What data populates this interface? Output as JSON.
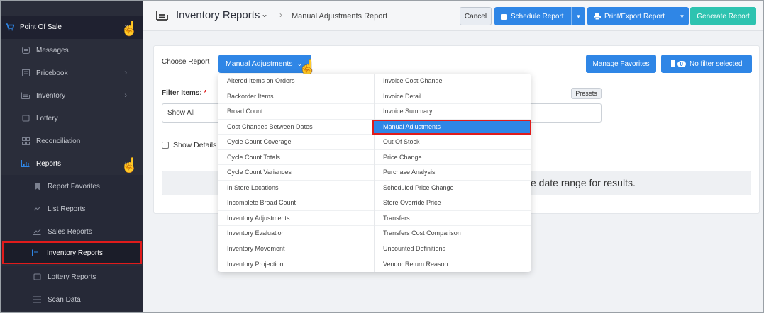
{
  "sidebar": {
    "pos_label": "Point Of Sale",
    "items": [
      {
        "label": "Messages",
        "icon": "messages-icon"
      },
      {
        "label": "Pricebook",
        "icon": "pricebook-icon"
      },
      {
        "label": "Inventory",
        "icon": "inventory-icon"
      },
      {
        "label": "Lottery",
        "icon": "lottery-icon"
      },
      {
        "label": "Reconciliation",
        "icon": "reconciliation-icon"
      },
      {
        "label": "Reports",
        "icon": "reports-icon"
      }
    ],
    "sub_items": [
      {
        "label": "Report Favorites",
        "icon": "bookmark-icon"
      },
      {
        "label": "List Reports",
        "icon": "list-chart-icon"
      },
      {
        "label": "Sales Reports",
        "icon": "sales-chart-icon"
      },
      {
        "label": "Inventory Reports",
        "icon": "inventory-report-icon"
      },
      {
        "label": "Lottery Reports",
        "icon": "lottery-report-icon"
      },
      {
        "label": "Scan Data",
        "icon": "scan-data-icon"
      }
    ]
  },
  "header": {
    "title": "Inventory Reports",
    "breadcrumb": "Manual Adjustments Report",
    "cancel": "Cancel",
    "schedule": "Schedule Report",
    "print": "Print/Export Report",
    "generate": "Generate Report"
  },
  "card": {
    "choose_report_label": "Choose Report",
    "selected_report": "Manual Adjustments",
    "manage_favorites": "Manage Favorites",
    "filter_count": "0",
    "no_filter": "No filter selected",
    "filter_items_label": "Filter Items:",
    "required_mark": "*",
    "filter_value": "Show All",
    "presets": "Presets",
    "show_details": "Show Details",
    "message": "e date range for results."
  },
  "menu": {
    "left": [
      "Altered Items on Orders",
      "Backorder Items",
      "Broad Count",
      "Cost Changes Between Dates",
      "Cycle Count Coverage",
      "Cycle Count Totals",
      "Cycle Count Variances",
      "In Store Locations",
      "Incomplete Broad Count",
      "Inventory Adjustments",
      "Inventory Evaluation",
      "Inventory Movement",
      "Inventory Projection"
    ],
    "right": [
      "Invoice Cost Change",
      "Invoice Detail",
      "Invoice Summary",
      "Manual Adjustments",
      "Out Of Stock",
      "Price Change",
      "Purchase Analysis",
      "Scheduled Price Change",
      "Store Override Price",
      "Transfers",
      "Transfers Cost Comparison",
      "Uncounted Definitions",
      "Vendor Return Reason"
    ],
    "selected": "Manual Adjustments"
  }
}
